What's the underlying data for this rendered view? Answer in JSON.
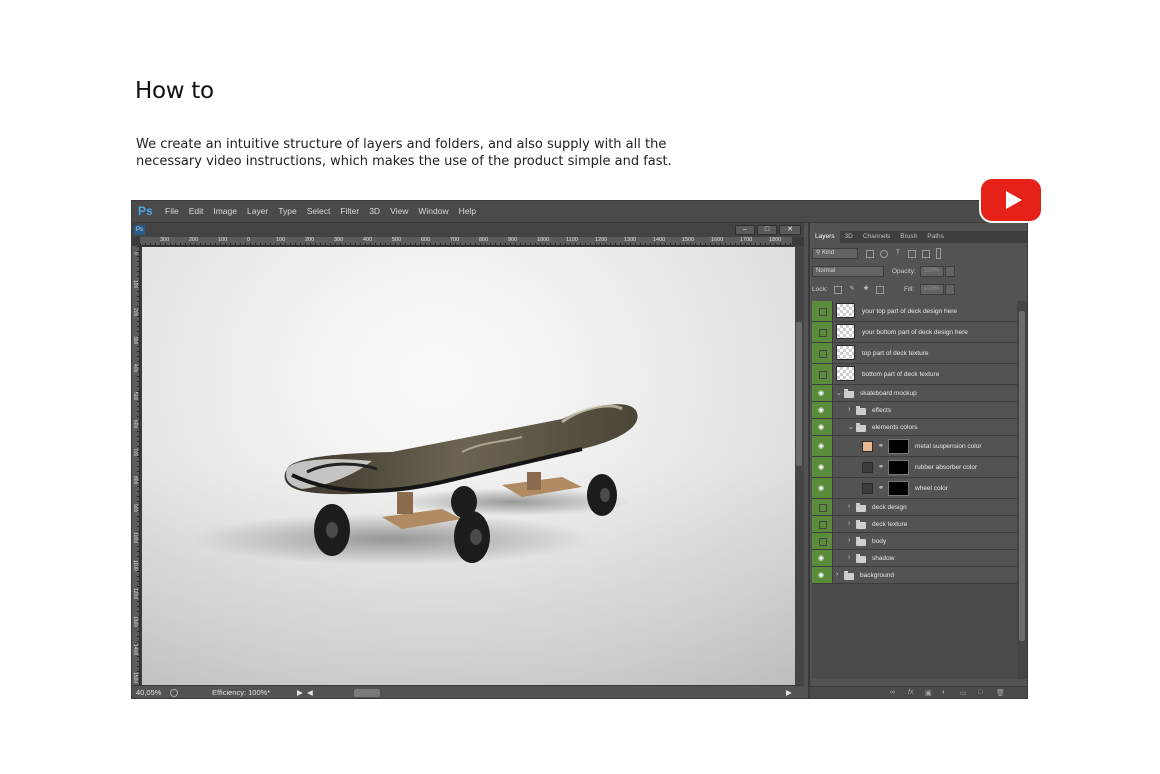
{
  "heading": "How to",
  "description": "We create an intuitive structure of layers and folders, and also supply with all the necessary video instructions, which makes the use of the product simple and fast.",
  "app": {
    "logo": "Ps",
    "menu": [
      "File",
      "Edit",
      "Image",
      "Layer",
      "Type",
      "Select",
      "Filter",
      "3D",
      "View",
      "Window",
      "Help"
    ],
    "doc_icon": "Ps",
    "window_buttons": [
      "minimize-icon",
      "maximize-icon",
      "close-icon"
    ],
    "ruler_h": [
      "300",
      "200",
      "100",
      "0",
      "100",
      "200",
      "300",
      "400",
      "500",
      "600",
      "700",
      "800",
      "900",
      "1000",
      "1100",
      "1200",
      "1300",
      "1400",
      "1500",
      "1600",
      "1700",
      "1800"
    ],
    "ruler_v": [
      "0",
      "100",
      "200",
      "300",
      "400",
      "500",
      "600",
      "700",
      "800",
      "900",
      "1000",
      "1100",
      "1200",
      "1300",
      "1400",
      "1500"
    ],
    "status": {
      "zoom": "40,05%",
      "info": "Efficiency: 100%*"
    }
  },
  "layers_panel": {
    "tabs": [
      "Layers",
      "3D",
      "Channels",
      "Brush",
      "Paths"
    ],
    "active_tab": "Layers",
    "filter_kind": "Kind",
    "blend_mode": "Normal",
    "opacity_label": "Opacity:",
    "opacity_value": "100%",
    "lock_label": "Lock:",
    "fill_label": "Fill:",
    "fill_value": "100%",
    "layers": [
      {
        "name": "your top part of deck design here",
        "type": "smart",
        "visible": false
      },
      {
        "name": "your bottom part of deck design here",
        "type": "smart",
        "visible": false
      },
      {
        "name": "top part of deck texture",
        "type": "smart",
        "visible": false
      },
      {
        "name": "bottom part of deck texture",
        "type": "smart",
        "visible": false
      },
      {
        "name": "skateboard mockup",
        "type": "group-open",
        "visible": true
      },
      {
        "name": "effects",
        "type": "group",
        "visible": true
      },
      {
        "name": "elements colors",
        "type": "group-open",
        "visible": true
      },
      {
        "name": "metal suspension color",
        "type": "fill",
        "visible": true,
        "color": "#e9b78c"
      },
      {
        "name": "rubber absorber color",
        "type": "fill",
        "visible": true,
        "color": "#3c3c3c"
      },
      {
        "name": "wheel color",
        "type": "fill",
        "visible": true,
        "color": "#3c3c3c"
      },
      {
        "name": "deck design",
        "type": "group",
        "visible": false
      },
      {
        "name": "deck texture",
        "type": "group",
        "visible": false
      },
      {
        "name": "body",
        "type": "group",
        "visible": false
      },
      {
        "name": "shadow",
        "type": "group",
        "visible": true
      },
      {
        "name": "background",
        "type": "group",
        "visible": true
      }
    ]
  },
  "colors": {
    "accent_green": "#5a8c3c",
    "youtube_red": "#e62117",
    "ps_blue": "#4ea6e8"
  }
}
